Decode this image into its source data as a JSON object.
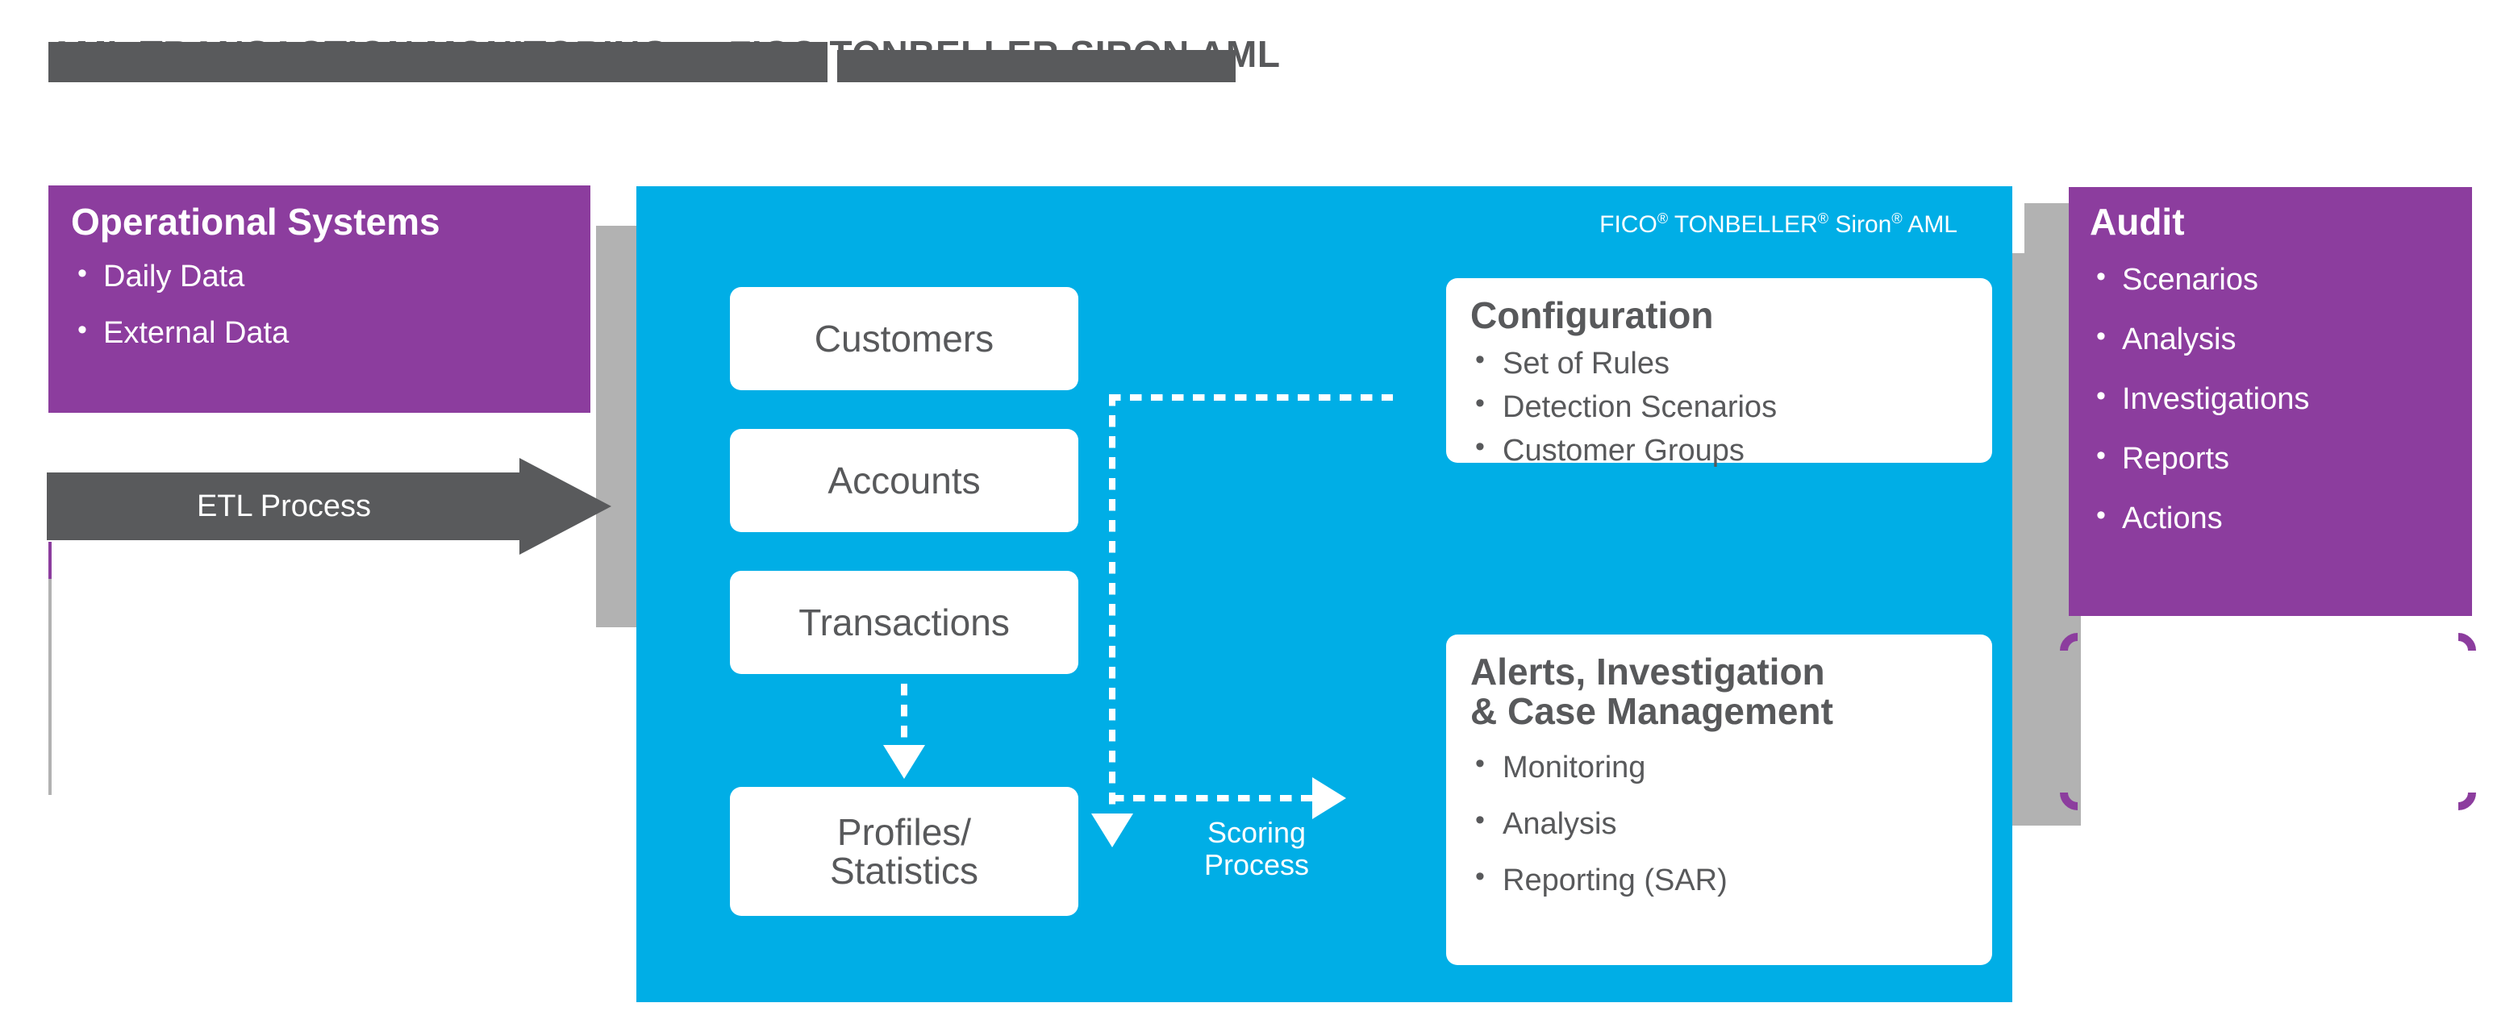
{
  "title": {
    "text": "AML TRANSACTION MONITORING — FICO TONBELLER SIRON AML",
    "redacted": true
  },
  "colors": {
    "purple": "#8c3d9e",
    "cyan": "#00aee6",
    "gray_dark": "#595a5c",
    "gray_light": "#b2b2b2",
    "text_gray": "#58595b",
    "white": "#ffffff"
  },
  "left_panel": {
    "title": "Operational Systems",
    "bullets": [
      "Daily Data",
      "External Data"
    ]
  },
  "etl_arrow": {
    "label": "ETL Process"
  },
  "platform": {
    "label_prefix": "FICO",
    "label": "FICO® TONBELLER® Siron® AML",
    "brand_parts": {
      "p1": "FICO",
      "r1": "®",
      "p2": " TONBELLER",
      "r2": "®",
      "p3": " Siron",
      "r3": "®",
      "p4": " AML"
    }
  },
  "data_cards": [
    {
      "label": "Customers"
    },
    {
      "label": "Accounts"
    },
    {
      "label": "Transactions"
    },
    {
      "label": "Profiles/\nStatistics",
      "line1": "Profiles/",
      "line2": "Statistics"
    }
  ],
  "configuration_card": {
    "title": "Configuration",
    "bullets": [
      "Set of Rules",
      "Detection Scenarios",
      "Customer Groups"
    ]
  },
  "alerts_card": {
    "title_line1": "Alerts, Investigation",
    "title_line2": "& Case Management",
    "bullets": [
      "Monitoring",
      "Analysis",
      "Reporting (SAR)"
    ]
  },
  "scoring_arrow": {
    "line1": "Scoring",
    "line2": "Process"
  },
  "right_panel": {
    "title": "Audit",
    "bullets": [
      "Scenarios",
      "Analysis",
      "Investigations",
      "Reports",
      "Actions"
    ]
  }
}
